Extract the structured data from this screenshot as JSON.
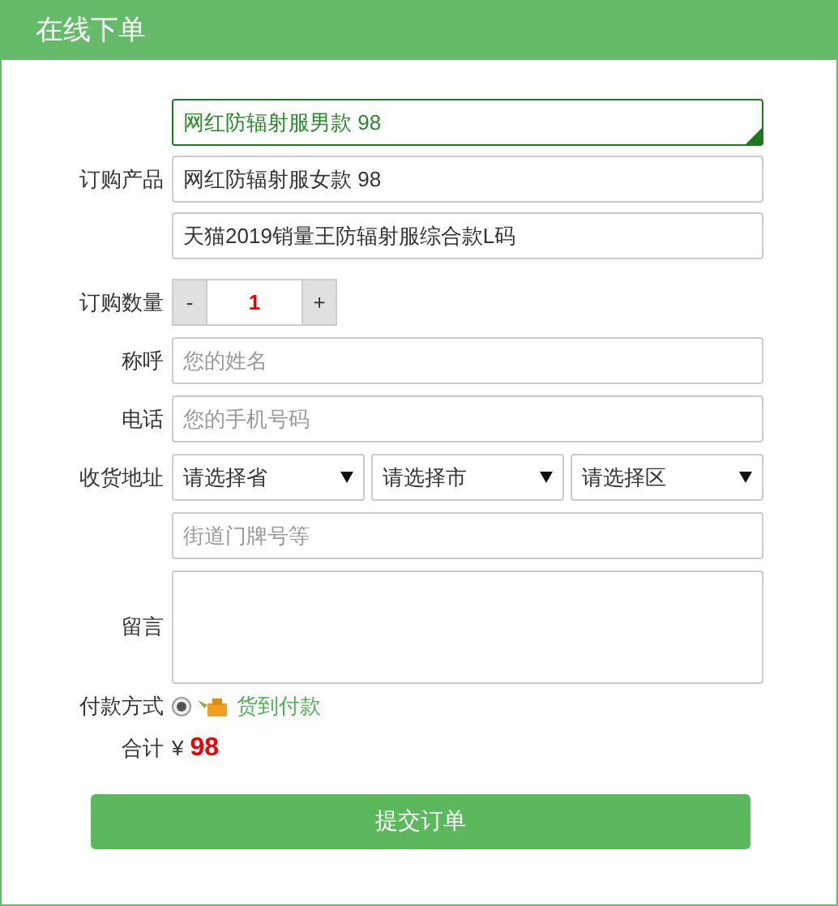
{
  "header": {
    "title": "在线下单"
  },
  "product": {
    "label": "订购产品",
    "options": [
      {
        "text": "网红防辐射服男款 98",
        "selected": true
      },
      {
        "text": "网红防辐射服女款 98",
        "selected": false
      },
      {
        "text": "天猫2019销量王防辐射服综合款L码",
        "selected": false
      }
    ]
  },
  "quantity": {
    "label": "订购数量",
    "minus": "-",
    "value": "1",
    "plus": "+"
  },
  "name": {
    "label": "称呼",
    "placeholder": "您的姓名"
  },
  "phone": {
    "label": "电话",
    "placeholder": "您的手机号码"
  },
  "address": {
    "label": "收货地址",
    "selects": [
      {
        "value": "请选择省"
      },
      {
        "value": "请选择市"
      },
      {
        "value": "请选择区"
      }
    ],
    "street_placeholder": "街道门牌号等"
  },
  "message": {
    "label": "留言"
  },
  "payment": {
    "label": "付款方式",
    "options": [
      {
        "text": "货到付款",
        "selected": true
      }
    ]
  },
  "total": {
    "label": "合计",
    "currency": "¥",
    "amount": "98"
  },
  "submit": {
    "label": "提交订单"
  }
}
